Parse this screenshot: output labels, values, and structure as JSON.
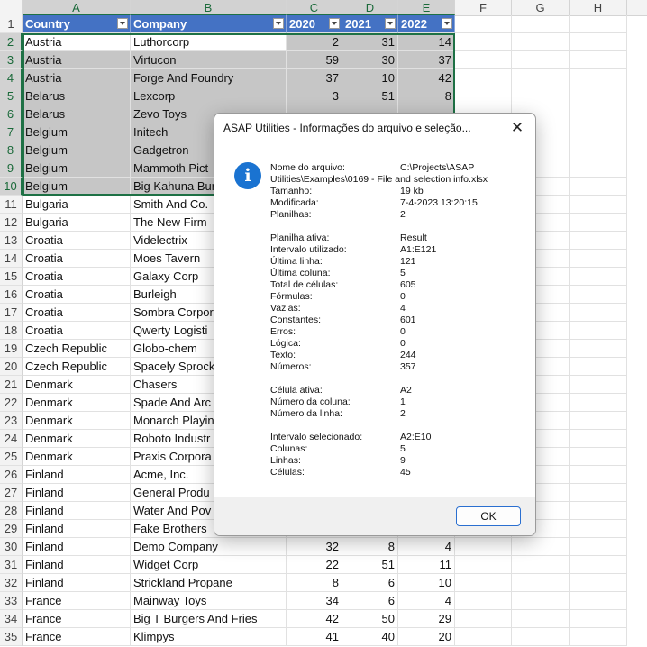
{
  "sheet": {
    "columns": [
      "A",
      "B",
      "C",
      "D",
      "E",
      "F",
      "G",
      "H"
    ],
    "headers": [
      "Country",
      "Company",
      "2020",
      "2021",
      "2022"
    ],
    "rows": [
      {
        "n": "2",
        "a": "Austria",
        "b": "Luthorcorp",
        "c": "2",
        "d": "31",
        "e": "14"
      },
      {
        "n": "3",
        "a": "Austria",
        "b": "Virtucon",
        "c": "59",
        "d": "30",
        "e": "37"
      },
      {
        "n": "4",
        "a": "Austria",
        "b": "Forge And Foundry",
        "c": "37",
        "d": "10",
        "e": "42"
      },
      {
        "n": "5",
        "a": "Belarus",
        "b": "Lexcorp",
        "c": "3",
        "d": "51",
        "e": "8"
      },
      {
        "n": "6",
        "a": "Belarus",
        "b": "Zevo Toys",
        "c": "",
        "d": "",
        "e": ""
      },
      {
        "n": "7",
        "a": "Belgium",
        "b": "Initech",
        "c": "",
        "d": "",
        "e": ""
      },
      {
        "n": "8",
        "a": "Belgium",
        "b": "Gadgetron",
        "c": "",
        "d": "",
        "e": ""
      },
      {
        "n": "9",
        "a": "Belgium",
        "b": "Mammoth Pict",
        "c": "",
        "d": "",
        "e": ""
      },
      {
        "n": "10",
        "a": "Belgium",
        "b": "Big Kahuna Bur",
        "c": "",
        "d": "",
        "e": ""
      },
      {
        "n": "11",
        "a": "Bulgaria",
        "b": "Smith And Co.",
        "c": "",
        "d": "",
        "e": ""
      },
      {
        "n": "12",
        "a": "Bulgaria",
        "b": "The New Firm",
        "c": "",
        "d": "",
        "e": ""
      },
      {
        "n": "13",
        "a": "Croatia",
        "b": "Videlectrix",
        "c": "",
        "d": "",
        "e": ""
      },
      {
        "n": "14",
        "a": "Croatia",
        "b": "Moes Tavern",
        "c": "",
        "d": "",
        "e": ""
      },
      {
        "n": "15",
        "a": "Croatia",
        "b": "Galaxy Corp",
        "c": "",
        "d": "",
        "e": ""
      },
      {
        "n": "16",
        "a": "Croatia",
        "b": "Burleigh",
        "c": "",
        "d": "",
        "e": ""
      },
      {
        "n": "17",
        "a": "Croatia",
        "b": "Sombra Corpor",
        "c": "",
        "d": "",
        "e": ""
      },
      {
        "n": "18",
        "a": "Croatia",
        "b": "Qwerty Logisti",
        "c": "",
        "d": "",
        "e": ""
      },
      {
        "n": "19",
        "a": "Czech Republic",
        "b": "Globo-chem",
        "c": "",
        "d": "",
        "e": ""
      },
      {
        "n": "20",
        "a": "Czech Republic",
        "b": "Spacely Sprock",
        "c": "",
        "d": "",
        "e": ""
      },
      {
        "n": "21",
        "a": "Denmark",
        "b": "Chasers",
        "c": "",
        "d": "",
        "e": ""
      },
      {
        "n": "22",
        "a": "Denmark",
        "b": "Spade And Arc",
        "c": "",
        "d": "",
        "e": ""
      },
      {
        "n": "23",
        "a": "Denmark",
        "b": "Monarch Playin",
        "c": "",
        "d": "",
        "e": ""
      },
      {
        "n": "24",
        "a": "Denmark",
        "b": "Roboto Industr",
        "c": "",
        "d": "",
        "e": ""
      },
      {
        "n": "25",
        "a": "Denmark",
        "b": "Praxis Corpora",
        "c": "",
        "d": "",
        "e": ""
      },
      {
        "n": "26",
        "a": "Finland",
        "b": "Acme, Inc.",
        "c": "",
        "d": "",
        "e": ""
      },
      {
        "n": "27",
        "a": "Finland",
        "b": "General Produ",
        "c": "",
        "d": "",
        "e": ""
      },
      {
        "n": "28",
        "a": "Finland",
        "b": "Water And Pov",
        "c": "",
        "d": "",
        "e": ""
      },
      {
        "n": "29",
        "a": "Finland",
        "b": "Fake Brothers",
        "c": "",
        "d": "",
        "e": ""
      },
      {
        "n": "30",
        "a": "Finland",
        "b": "Demo Company",
        "c": "32",
        "d": "8",
        "e": "4"
      },
      {
        "n": "31",
        "a": "Finland",
        "b": "Widget Corp",
        "c": "22",
        "d": "51",
        "e": "11"
      },
      {
        "n": "32",
        "a": "Finland",
        "b": "Strickland Propane",
        "c": "8",
        "d": "6",
        "e": "10"
      },
      {
        "n": "33",
        "a": "France",
        "b": "Mainway Toys",
        "c": "34",
        "d": "6",
        "e": "4"
      },
      {
        "n": "34",
        "a": "France",
        "b": "Big T Burgers And Fries",
        "c": "42",
        "d": "50",
        "e": "29"
      },
      {
        "n": "35",
        "a": "France",
        "b": "Klimpys",
        "c": "41",
        "d": "40",
        "e": "20"
      }
    ]
  },
  "dialog": {
    "title": "ASAP Utilities - Informações do arquivo e seleção...",
    "close_glyph": "✕",
    "icon_glyph": "i",
    "file_label": "Nome do arquivo:",
    "file_value_line1": "C:\\Projects\\ASAP",
    "file_value_line2": "Utilities\\Examples\\0169 - File and selection info.xlsx",
    "file_info": [
      {
        "k": "Tamanho:",
        "v": "19 kb"
      },
      {
        "k": "Modificada:",
        "v": "7-4-2023 13:20:15"
      },
      {
        "k": "Planilhas:",
        "v": "2"
      }
    ],
    "sheet_info": [
      {
        "k": "Planilha ativa:",
        "v": "Result"
      },
      {
        "k": "Intervalo utilizado:",
        "v": "A1:E121"
      },
      {
        "k": "Última linha:",
        "v": "121"
      },
      {
        "k": "Última coluna:",
        "v": "5"
      },
      {
        "k": "Total de células:",
        "v": "605"
      },
      {
        "k": "Fórmulas:",
        "v": "0"
      },
      {
        "k": "Vazias:",
        "v": "4"
      },
      {
        "k": "Constantes:",
        "v": "601"
      },
      {
        "k": "Erros:",
        "v": "0"
      },
      {
        "k": "Lógica:",
        "v": "0"
      },
      {
        "k": "Texto:",
        "v": "244"
      },
      {
        "k": "Números:",
        "v": "357"
      }
    ],
    "cell_info": [
      {
        "k": "Célula ativa:",
        "v": "A2"
      },
      {
        "k": "Número da coluna:",
        "v": "1"
      },
      {
        "k": "Número da linha:",
        "v": "2"
      }
    ],
    "selection_info": [
      {
        "k": "Intervalo selecionado:",
        "v": "A2:E10"
      },
      {
        "k": "Colunas:",
        "v": "5"
      },
      {
        "k": "Linhas:",
        "v": "9"
      },
      {
        "k": "Células:",
        "v": "45"
      }
    ],
    "ok_label": "OK"
  }
}
